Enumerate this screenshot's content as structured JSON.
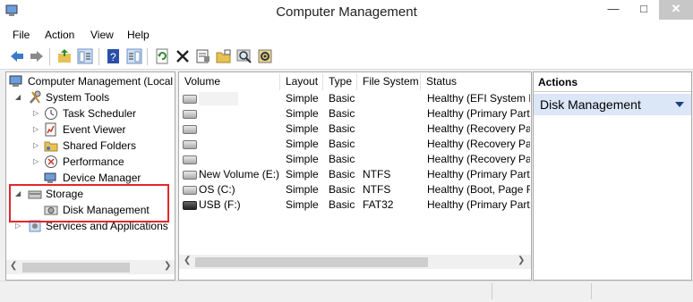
{
  "window": {
    "title": "Computer Management",
    "min": "—",
    "max": "□",
    "close": "✕"
  },
  "menu": [
    "File",
    "Action",
    "View",
    "Help"
  ],
  "toolbar": [
    "back-icon",
    "forward-icon",
    "up-folder-icon",
    "show-hide-tree-icon",
    "help-icon",
    "show-hide-action-pane-icon",
    "refresh-icon",
    "delete-icon",
    "properties-icon",
    "open-folder-icon",
    "search-icon",
    "settings-icon"
  ],
  "tree": {
    "root": "Computer Management (Local",
    "system_tools": "System Tools",
    "task_scheduler": "Task Scheduler",
    "event_viewer": "Event Viewer",
    "shared_folders": "Shared Folders",
    "performance": "Performance",
    "device_manager": "Device Manager",
    "storage": "Storage",
    "disk_management": "Disk Management",
    "services": "Services and Applications"
  },
  "list": {
    "columns": [
      "Volume",
      "Layout",
      "Type",
      "File System",
      "Status"
    ],
    "rows": [
      {
        "volume": "",
        "layout": "Simple",
        "type": "Basic",
        "fs": "",
        "status": "Healthy (EFI System P"
      },
      {
        "volume": "",
        "layout": "Simple",
        "type": "Basic",
        "fs": "",
        "status": "Healthy (Primary Part"
      },
      {
        "volume": "",
        "layout": "Simple",
        "type": "Basic",
        "fs": "",
        "status": "Healthy (Recovery Pa"
      },
      {
        "volume": "",
        "layout": "Simple",
        "type": "Basic",
        "fs": "",
        "status": "Healthy (Recovery Pa"
      },
      {
        "volume": "",
        "layout": "Simple",
        "type": "Basic",
        "fs": "",
        "status": "Healthy (Recovery Pa"
      },
      {
        "volume": "New Volume (E:)",
        "layout": "Simple",
        "type": "Basic",
        "fs": "NTFS",
        "status": "Healthy (Primary Part"
      },
      {
        "volume": "OS (C:)",
        "layout": "Simple",
        "type": "Basic",
        "fs": "NTFS",
        "status": "Healthy (Boot, Page F"
      },
      {
        "volume": "USB (F:)",
        "layout": "Simple",
        "type": "Basic",
        "fs": "FAT32",
        "status": "Healthy (Primary Part"
      }
    ]
  },
  "actions": {
    "header": "Actions",
    "item": "Disk Management"
  },
  "colors": {
    "selection": "#dbe7f7",
    "highlight_box": "#e2262a"
  }
}
